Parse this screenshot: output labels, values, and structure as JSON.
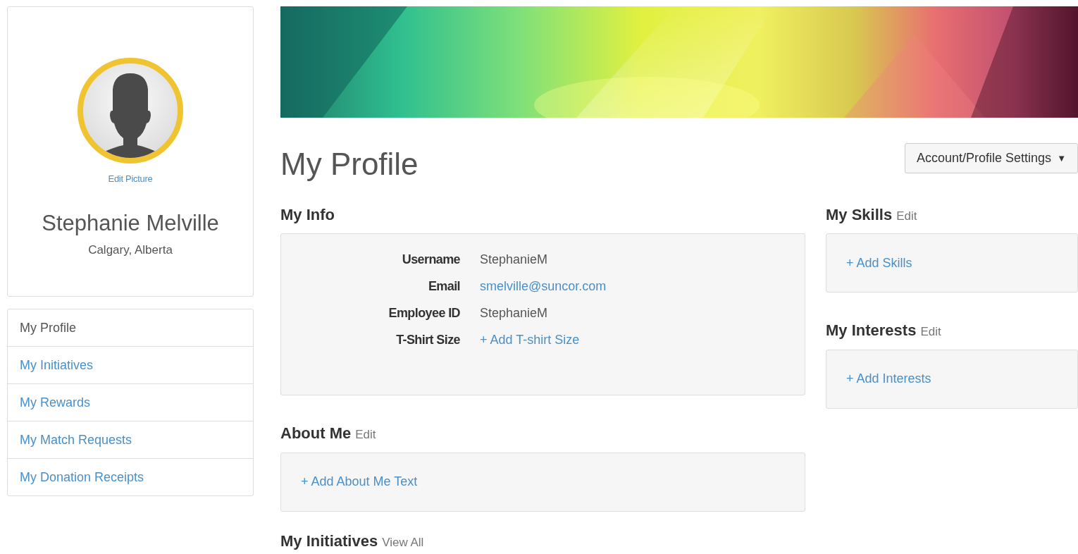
{
  "profile_card": {
    "edit_picture": "Edit Picture",
    "name": "Stephanie Melville",
    "location": "Calgary, Alberta"
  },
  "sidebar": {
    "items": [
      {
        "label": "My Profile",
        "selected": true
      },
      {
        "label": "My Initiatives",
        "selected": false
      },
      {
        "label": "My Rewards",
        "selected": false
      },
      {
        "label": "My Match Requests",
        "selected": false
      },
      {
        "label": "My Donation Receipts",
        "selected": false
      }
    ]
  },
  "page_title": "My Profile",
  "settings_button": {
    "label": "Account/Profile Settings",
    "caret": "▼"
  },
  "my_info": {
    "title": "My Info",
    "fields": [
      {
        "label": "Username",
        "value": "StephanieM",
        "kind": "text"
      },
      {
        "label": "Email",
        "value": "smelville@suncor.com",
        "kind": "link"
      },
      {
        "label": "Employee ID",
        "value": "StephanieM",
        "kind": "text"
      },
      {
        "label": "T-Shirt Size",
        "value": "+ Add T-shirt Size",
        "kind": "link"
      }
    ]
  },
  "about_me": {
    "title": "About Me",
    "action": "Edit",
    "add_link": "+ Add About Me Text"
  },
  "my_initiatives": {
    "title": "My Initiatives",
    "action": "View All"
  },
  "my_skills": {
    "title": "My Skills",
    "action": "Edit",
    "add_link": "+ Add Skills"
  },
  "my_interests": {
    "title": "My Interests",
    "action": "Edit",
    "add_link": "+ Add Interests"
  }
}
